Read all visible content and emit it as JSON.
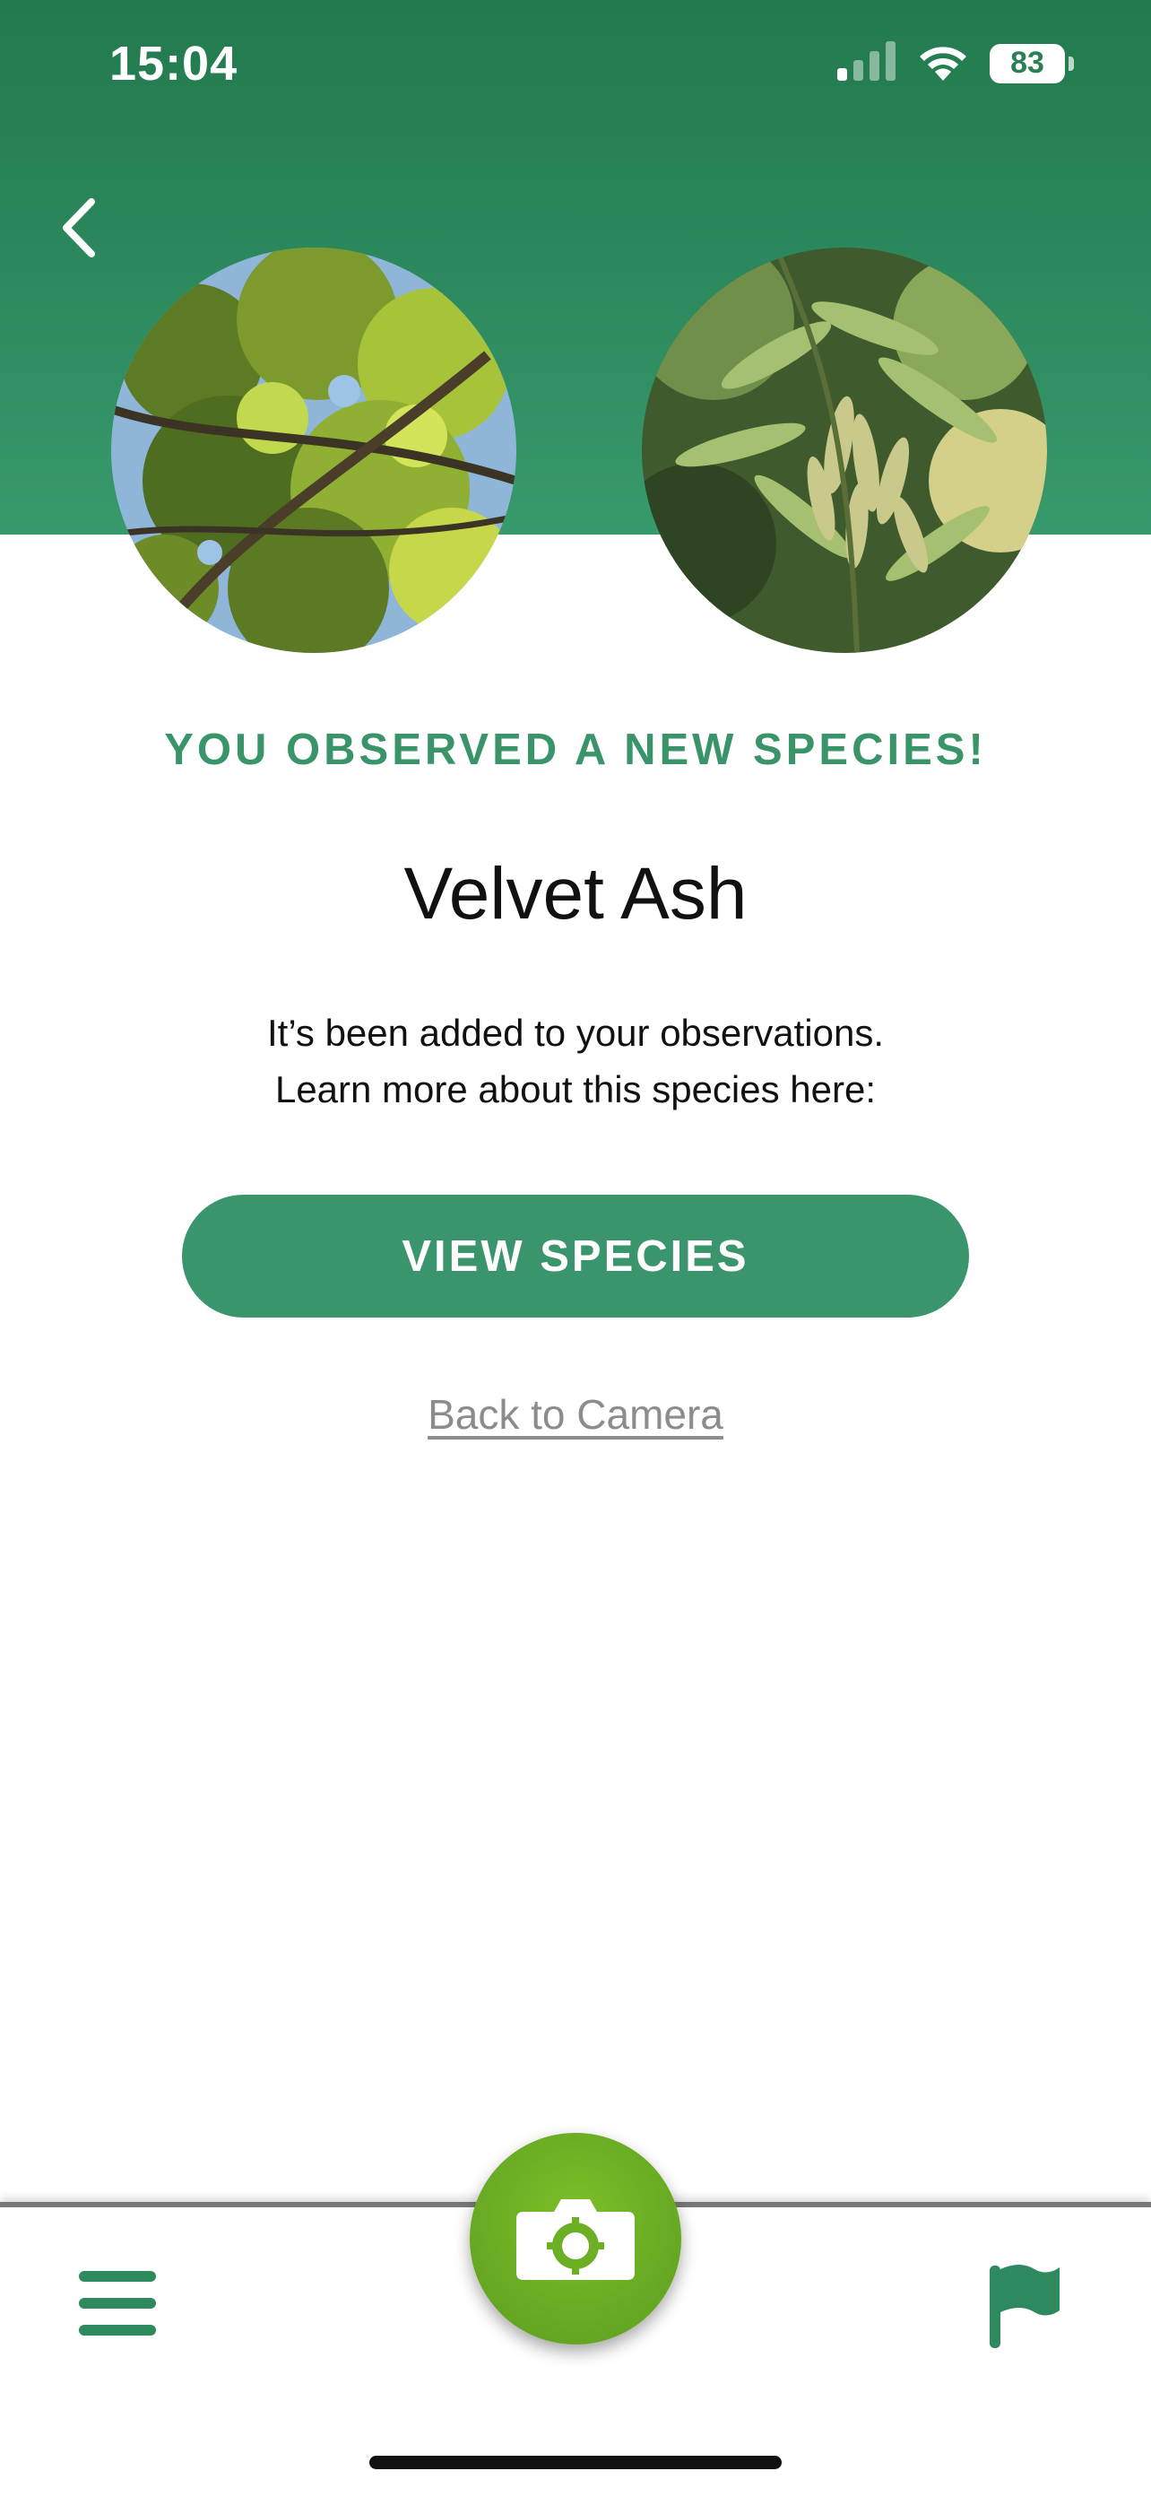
{
  "status_bar": {
    "time": "15:04",
    "battery": "83",
    "icons": [
      "signal-icon",
      "wifi-icon",
      "battery-icon"
    ]
  },
  "header": {
    "back_icon": "chevron-left-icon",
    "photos": [
      "tree-canopy-photo",
      "leaves-and-seeds-photo"
    ]
  },
  "main": {
    "headline": "YOU OBSERVED A NEW SPECIES!",
    "species_name": "Velvet Ash",
    "message_line1": "It’s been added to your observations.",
    "message_line2": "Learn more about this species here:",
    "view_button": "VIEW SPECIES",
    "back_link": "Back to Camera"
  },
  "bottom_nav": {
    "left_icon": "menu-icon",
    "center_icon": "camera-icon",
    "right_icon": "flag-icon"
  },
  "colors": {
    "header_green": "#2b8a5c",
    "accent_green": "#3b956c",
    "camera_green": "#6cae24",
    "link_gray": "#8c8c8c"
  }
}
